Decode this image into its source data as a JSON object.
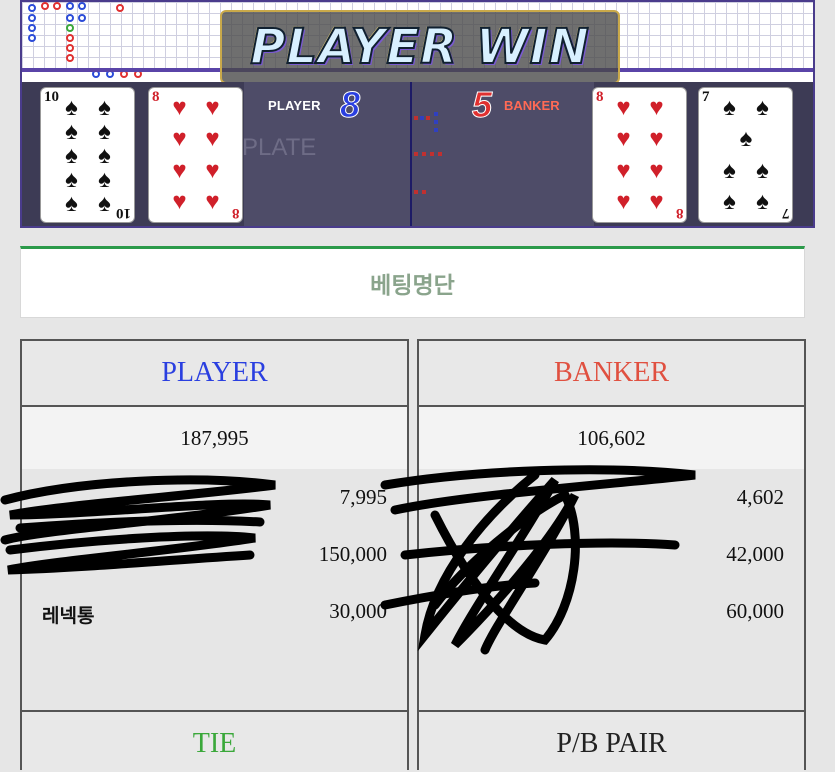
{
  "game": {
    "result_banner": "PLAYER WIN",
    "plate_watermark": "PLATE",
    "player_label": "PLAYER",
    "player_score": "8",
    "banker_label": "BANKER",
    "banker_score": "5",
    "player_cards": [
      {
        "rank": "10",
        "suit": "♠",
        "color": "black"
      },
      {
        "rank": "8",
        "suit": "♥",
        "color": "red"
      }
    ],
    "banker_cards": [
      {
        "rank": "8",
        "suit": "♥",
        "color": "red"
      },
      {
        "rank": "7",
        "suit": "♠",
        "color": "black"
      }
    ],
    "colors": {
      "player": "#2a3fe0",
      "banker": "#e03030",
      "tie": "#3aa83a",
      "accent": "#2b9a4a"
    }
  },
  "betting_list": {
    "header": "베팅명단",
    "player": {
      "title": "PLAYER",
      "total": "187,995",
      "rows": [
        {
          "name": "",
          "amount": "7,995"
        },
        {
          "name": "",
          "amount": "150,000"
        },
        {
          "name": "레넥통",
          "amount": "30,000"
        }
      ]
    },
    "banker": {
      "title": "BANKER",
      "total": "106,602",
      "rows": [
        {
          "name": "",
          "amount": "4,602"
        },
        {
          "name": "",
          "amount": "42,000"
        },
        {
          "name": "",
          "amount": "60,000"
        }
      ]
    },
    "tie": {
      "title": "TIE"
    },
    "pair": {
      "title": "P/B PAIR"
    }
  }
}
